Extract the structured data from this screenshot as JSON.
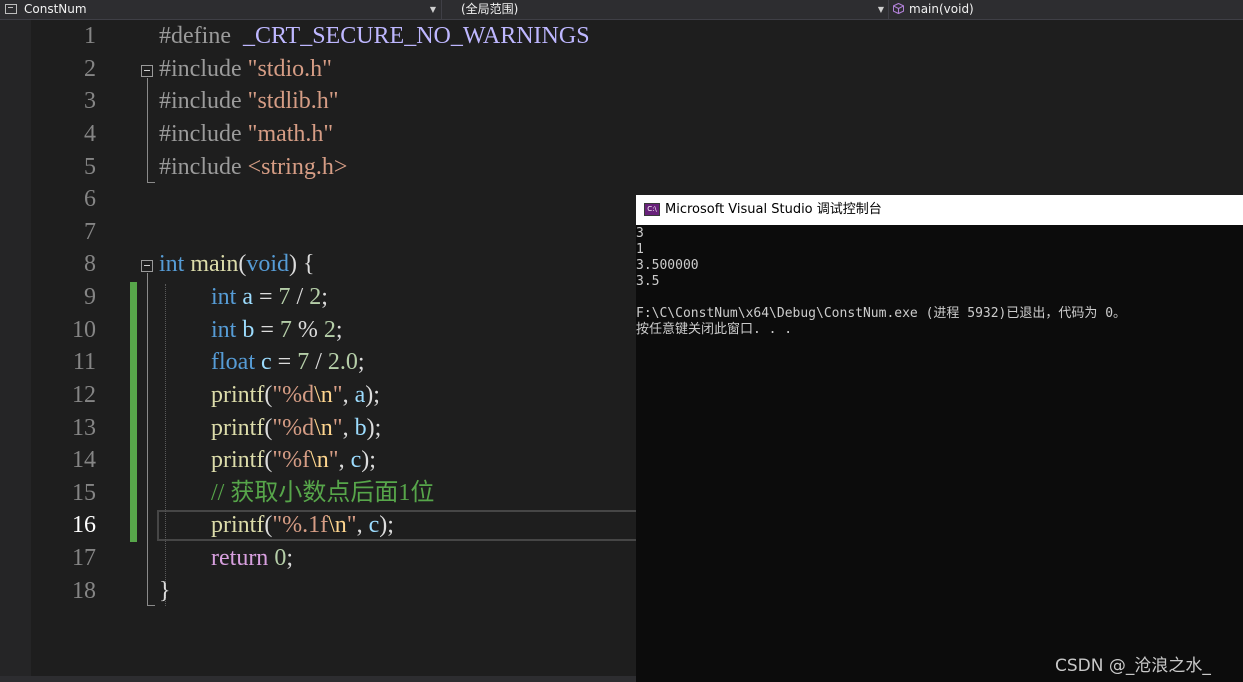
{
  "navbar": {
    "project": "ConstNum",
    "scope": "(全局范围)",
    "function": "main(void)"
  },
  "editor": {
    "line_numbers": [
      "1",
      "2",
      "3",
      "4",
      "5",
      "6",
      "7",
      "8",
      "9",
      "10",
      "11",
      "12",
      "13",
      "14",
      "15",
      "16",
      "17",
      "18"
    ],
    "active_line": "16",
    "code": {
      "l1_kw": "#define",
      "l1_macro": "_CRT_SECURE_NO_WARNINGS",
      "l2_kw": "#include",
      "l2_str": "\"stdio.h\"",
      "l3_kw": "#include",
      "l3_str": "\"stdlib.h\"",
      "l4_kw": "#include",
      "l4_str": "\"math.h\"",
      "l5_kw": "#include",
      "l5_str": "<string.h>",
      "l8_type": "int",
      "l8_fn": "main",
      "l8_open": "(",
      "l8_void": "void",
      "l8_close": ") {",
      "l9_type": "int",
      "l9_var": "a",
      "l9_op": " = ",
      "l9_n1": "7",
      "l9_op2": " / ",
      "l9_n2": "2",
      "l9_end": ";",
      "l10_type": "int",
      "l10_var": "b",
      "l10_op": " = ",
      "l10_n1": "7",
      "l10_op2": " % ",
      "l10_n2": "2",
      "l10_end": ";",
      "l11_type": "float",
      "l11_var": "c",
      "l11_op": " = ",
      "l11_n1": "7",
      "l11_op2": " / ",
      "l11_n2": "2.0",
      "l11_end": ";",
      "l12_fn": "printf",
      "l12_fmt": "\"%d",
      "l12_esc": "\\n",
      "l12_q": "\"",
      "l12_arg": "a",
      "l12_end": ");",
      "l13_fn": "printf",
      "l13_fmt": "\"%d",
      "l13_esc": "\\n",
      "l13_q": "\"",
      "l13_arg": "b",
      "l13_end": ");",
      "l14_fn": "printf",
      "l14_fmt": "\"%f",
      "l14_esc": "\\n",
      "l14_q": "\"",
      "l14_arg": "c",
      "l14_end": ");",
      "l15_cmt": "// 获取小数点后面1位",
      "l16_fn": "printf",
      "l16_fmt": "\"%.1f",
      "l16_esc": "\\n",
      "l16_q": "\"",
      "l16_arg": "c",
      "l16_end": ");",
      "l17_kw": "return",
      "l17_num": "0",
      "l17_end": ";",
      "l18_close": "}"
    }
  },
  "console": {
    "icon_label": "C:\\",
    "title": "Microsoft Visual Studio 调试控制台",
    "lines": [
      "3",
      "1",
      "3.500000",
      "3.5",
      "",
      "F:\\C\\ConstNum\\x64\\Debug\\ConstNum.exe (进程 5932)已退出，代码为 0。",
      "按任意键关闭此窗口. . ."
    ]
  },
  "watermark": "CSDN @_沧浪之水_",
  "colors": {
    "editor_bg": "#1e1e1e",
    "keyword": "#569cd6",
    "string": "#d69d85",
    "comment": "#57a64a",
    "function": "#dcdcaa",
    "variable": "#9cdcfe",
    "number": "#b5cea8",
    "change_bar": "#57a64a",
    "console_bg": "#0c0c0c"
  }
}
